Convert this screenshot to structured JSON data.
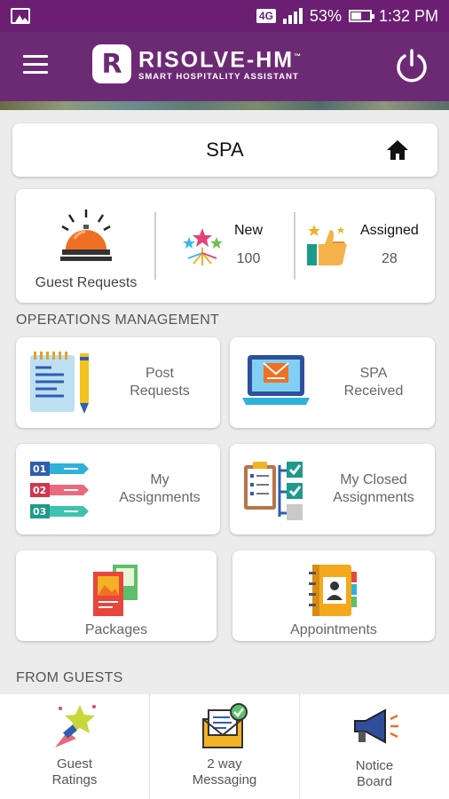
{
  "status_bar": {
    "network": "4G",
    "battery_percent": "53%",
    "battery_level": 0.53,
    "time": "1:32 PM"
  },
  "app_bar": {
    "logo_mark": "R",
    "logo_title": "RISOLVE-HM",
    "logo_subtitle": "SMART HOSPITALITY ASSISTANT",
    "trademark": "™"
  },
  "header": {
    "title": "SPA"
  },
  "stats": {
    "guest_requests_label": "Guest Requests",
    "new_label": "New",
    "new_value": "100",
    "assigned_label": "Assigned",
    "assigned_value": "28"
  },
  "sections": {
    "operations": "OPERATIONS MANAGEMENT",
    "from_guests": "FROM GUESTS"
  },
  "tiles": {
    "post_requests": {
      "line1": "Post",
      "line2": "Requests"
    },
    "spa_received": {
      "line1": "SPA",
      "line2": "Received"
    },
    "my_assignments": {
      "line1": "My",
      "line2": "Assignments"
    },
    "my_closed_assignments": {
      "line1": "My Closed",
      "line2": "Assignments"
    },
    "packages": {
      "label": "Packages"
    },
    "appointments": {
      "label": "Appointments"
    }
  },
  "list_badges": [
    "01",
    "02",
    "03"
  ],
  "bottom_nav": {
    "guest_ratings": {
      "line1": "Guest",
      "line2": "Ratings"
    },
    "messaging": {
      "line1": "2 way",
      "line2": "Messaging"
    },
    "notice_board": {
      "line1": "Notice",
      "line2": "Board"
    }
  },
  "colors": {
    "brand_purple": "#6d2a74",
    "status_purple": "#6b1f73"
  }
}
